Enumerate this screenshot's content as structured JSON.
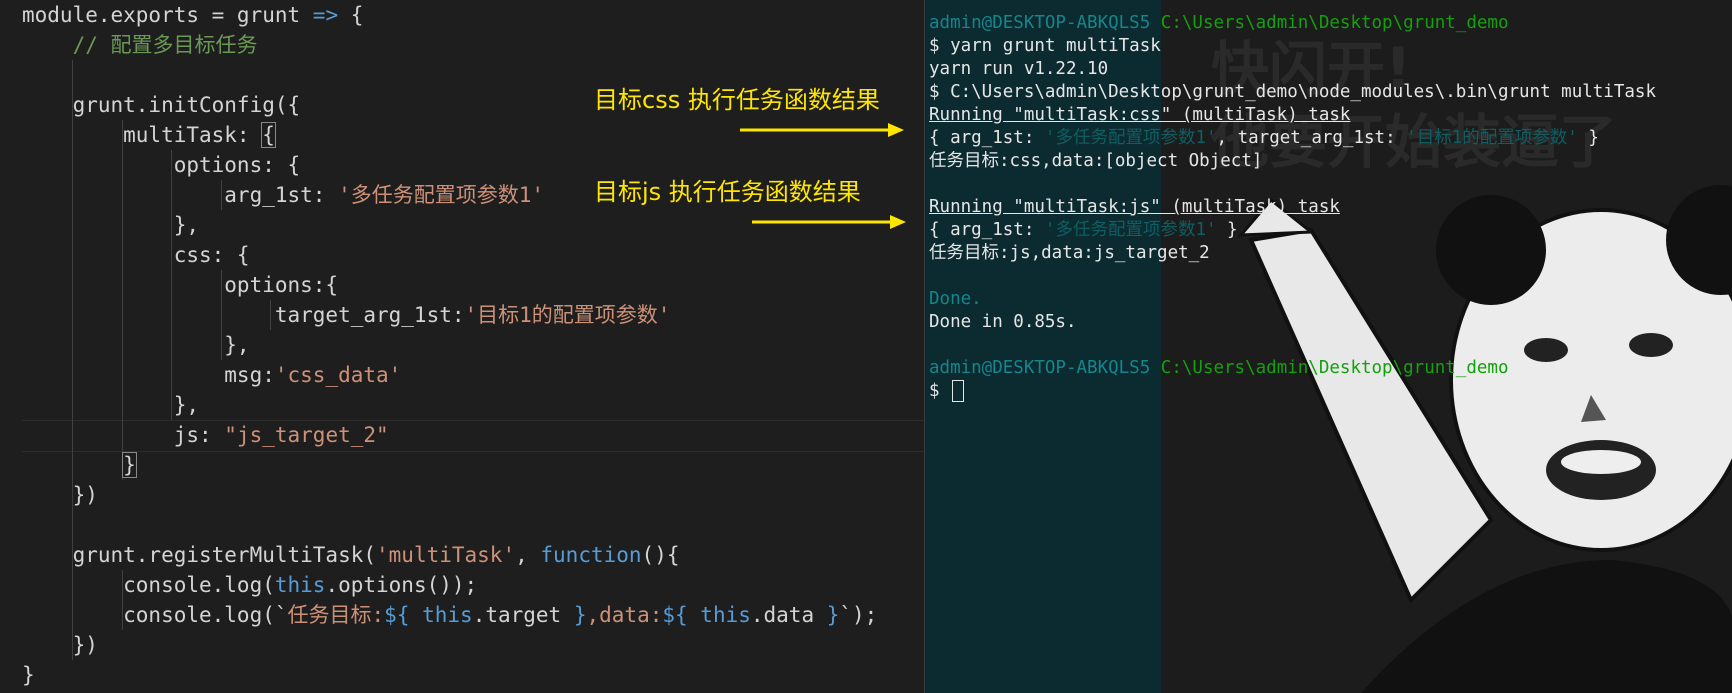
{
  "editor": {
    "lines": [
      {
        "tokens": [
          {
            "t": "module.exports = grunt ",
            "c": "t-prop"
          },
          {
            "t": "=>",
            "c": "t-kw"
          },
          {
            "t": " {",
            "c": "t-prop"
          }
        ]
      },
      {
        "tokens": [
          {
            "t": "    // 配置多目标任务",
            "c": "t-com"
          }
        ]
      },
      {
        "tokens": []
      },
      {
        "tokens": [
          {
            "t": "    grunt.initConfig({",
            "c": "t-prop"
          }
        ]
      },
      {
        "tokens": [
          {
            "t": "        multiTask: ",
            "c": "t-prop"
          },
          {
            "t": "{",
            "c": "t-prop",
            "hl": true
          }
        ]
      },
      {
        "tokens": [
          {
            "t": "            options: {",
            "c": "t-prop"
          }
        ]
      },
      {
        "tokens": [
          {
            "t": "                arg_1st: ",
            "c": "t-prop"
          },
          {
            "t": "'多任务配置项参数1'",
            "c": "t-str"
          }
        ]
      },
      {
        "tokens": [
          {
            "t": "            },",
            "c": "t-prop"
          }
        ]
      },
      {
        "tokens": [
          {
            "t": "            css: {",
            "c": "t-prop"
          }
        ]
      },
      {
        "tokens": [
          {
            "t": "                options:{",
            "c": "t-prop"
          }
        ]
      },
      {
        "tokens": [
          {
            "t": "                    target_arg_1st:",
            "c": "t-prop"
          },
          {
            "t": "'目标1的配置项参数'",
            "c": "t-str"
          }
        ]
      },
      {
        "tokens": [
          {
            "t": "                },",
            "c": "t-prop"
          }
        ]
      },
      {
        "tokens": [
          {
            "t": "                msg:",
            "c": "t-prop"
          },
          {
            "t": "'css_data'",
            "c": "t-str"
          }
        ]
      },
      {
        "tokens": [
          {
            "t": "            },",
            "c": "t-prop"
          }
        ]
      },
      {
        "tokens": [
          {
            "t": "            js: ",
            "c": "t-prop"
          },
          {
            "t": "\"js_target_2\"",
            "c": "t-str"
          }
        ]
      },
      {
        "tokens": [
          {
            "t": "        ",
            "c": "t-prop"
          },
          {
            "t": "}",
            "c": "t-prop",
            "hl": true
          }
        ]
      },
      {
        "tokens": [
          {
            "t": "    })",
            "c": "t-prop"
          }
        ]
      },
      {
        "tokens": []
      },
      {
        "tokens": [
          {
            "t": "    grunt.registerMultiTask(",
            "c": "t-prop"
          },
          {
            "t": "'multiTask'",
            "c": "t-str"
          },
          {
            "t": ", ",
            "c": "t-prop"
          },
          {
            "t": "function",
            "c": "t-kw"
          },
          {
            "t": "(){",
            "c": "t-prop"
          }
        ]
      },
      {
        "tokens": [
          {
            "t": "        console.log(",
            "c": "t-prop"
          },
          {
            "t": "this",
            "c": "t-kw"
          },
          {
            "t": ".options());",
            "c": "t-prop"
          }
        ]
      },
      {
        "tokens": [
          {
            "t": "        console.log(`",
            "c": "t-prop"
          },
          {
            "t": "任务目标:",
            "c": "t-str"
          },
          {
            "t": "${",
            "c": "t-kw"
          },
          {
            "t": " this",
            "c": "t-kw"
          },
          {
            "t": ".target ",
            "c": "t-prop"
          },
          {
            "t": "}",
            "c": "t-kw"
          },
          {
            "t": ",data:",
            "c": "t-str"
          },
          {
            "t": "${",
            "c": "t-kw"
          },
          {
            "t": " this",
            "c": "t-kw"
          },
          {
            "t": ".data ",
            "c": "t-prop"
          },
          {
            "t": "}",
            "c": "t-kw"
          },
          {
            "t": "`);",
            "c": "t-prop"
          }
        ]
      },
      {
        "tokens": [
          {
            "t": "    })",
            "c": "t-prop"
          }
        ]
      },
      {
        "tokens": [
          {
            "t": "}",
            "c": "t-prop"
          }
        ]
      }
    ]
  },
  "terminal": {
    "lines": [
      {
        "segs": [
          {
            "t": "admin@DESKTOP-ABKQLS5 ",
            "c": "c-teal"
          },
          {
            "t": "C:\\Users\\admin\\Desktop\\grunt_demo",
            "c": "c-green"
          }
        ]
      },
      {
        "segs": [
          {
            "t": "$ yarn grunt multiTask",
            "c": "c-white"
          }
        ]
      },
      {
        "segs": [
          {
            "t": "yarn run v1.22.10",
            "c": "c-white"
          }
        ]
      },
      {
        "segs": [
          {
            "t": "$ C:\\Users\\admin\\Desktop\\grunt_demo\\node_modules\\.bin\\grunt multiTask",
            "c": "c-white"
          }
        ]
      },
      {
        "segs": [
          {
            "t": "Running \"multiTask:css\" (multiTask) task",
            "c": "c-white uline"
          }
        ]
      },
      {
        "segs": [
          {
            "t": "{ arg_1st: ",
            "c": "c-white"
          },
          {
            "t": "'多任务配置项参数1'",
            "c": "c-dteal"
          },
          {
            "t": ", target_arg_1st: ",
            "c": "c-white"
          },
          {
            "t": "'目标1的配置项参数'",
            "c": "c-dteal"
          },
          {
            "t": " }",
            "c": "c-white"
          }
        ]
      },
      {
        "segs": [
          {
            "t": "任务目标:css,data:[object Object]",
            "c": "c-white"
          }
        ]
      },
      {
        "segs": []
      },
      {
        "segs": [
          {
            "t": "Running \"multiTask:js\" (multiTask) task",
            "c": "c-white uline"
          }
        ]
      },
      {
        "segs": [
          {
            "t": "{ arg_1st: ",
            "c": "c-white"
          },
          {
            "t": "'多任务配置项参数1'",
            "c": "c-dteal"
          },
          {
            "t": " }",
            "c": "c-white"
          }
        ]
      },
      {
        "segs": [
          {
            "t": "任务目标:js,data:js_target_2",
            "c": "c-white"
          }
        ]
      },
      {
        "segs": []
      },
      {
        "segs": [
          {
            "t": "Done.",
            "c": "c-teal"
          }
        ]
      },
      {
        "segs": [
          {
            "t": "Done in 0.85s.",
            "c": "c-white"
          }
        ]
      },
      {
        "segs": []
      },
      {
        "segs": [
          {
            "t": "admin@DESKTOP-ABKQLS5 ",
            "c": "c-teal"
          },
          {
            "t": "C:\\Users\\admin\\Desktop\\grunt_demo",
            "c": "c-green"
          }
        ]
      },
      {
        "segs": [
          {
            "t": "$ ",
            "c": "c-white"
          }
        ],
        "cursor": true
      }
    ]
  },
  "meme": {
    "line1": "快闪开!",
    "line2": "他要开始装逼了"
  },
  "annotations": {
    "css_result": "目标css 执行任务函数结果",
    "js_result": "目标js 执行任务函数结果"
  },
  "colors": {
    "annotation": "#ffe600",
    "terminal_bg": "#0c2b31",
    "editor_bg": "#1e1e1e"
  }
}
